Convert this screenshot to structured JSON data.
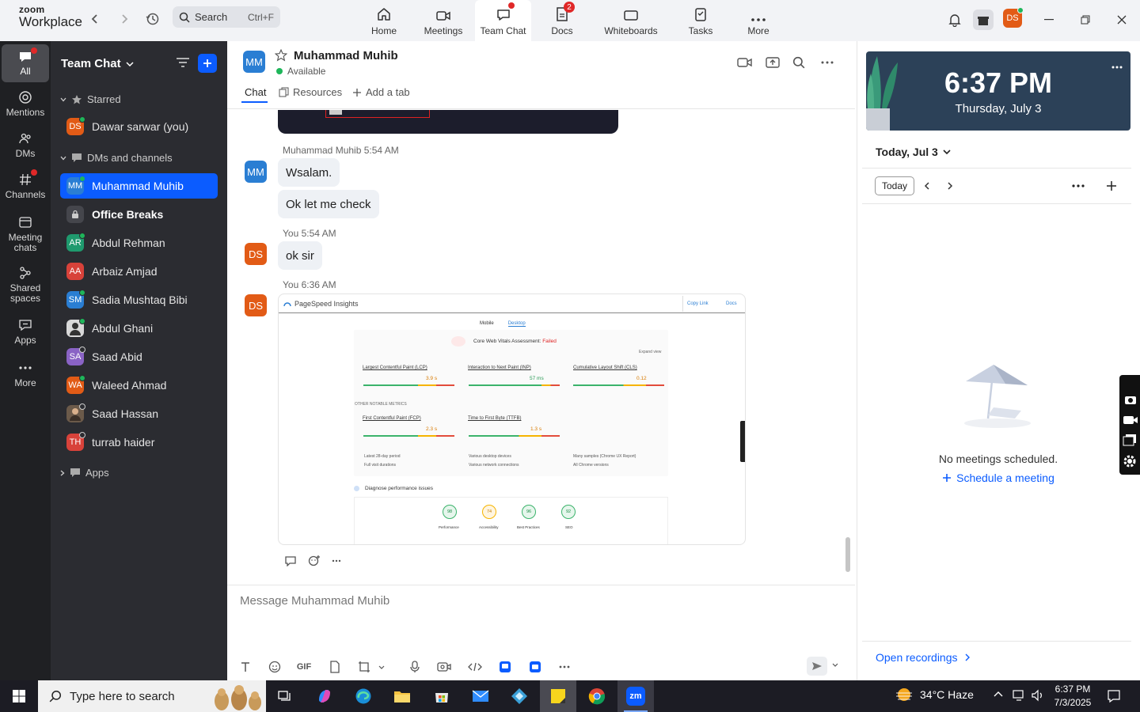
{
  "app": {
    "logo_line1": "zoom",
    "logo_line2": "Workplace"
  },
  "search": {
    "label": "Search",
    "shortcut": "Ctrl+F"
  },
  "nav": {
    "tabs": [
      {
        "label": "Home"
      },
      {
        "label": "Meetings"
      },
      {
        "label": "Team Chat"
      },
      {
        "label": "Docs",
        "badge": "2"
      },
      {
        "label": "Whiteboards"
      },
      {
        "label": "Tasks"
      },
      {
        "label": "More"
      }
    ]
  },
  "user": {
    "initials": "DS"
  },
  "rail": {
    "items": [
      {
        "label": "All"
      },
      {
        "label": "Mentions"
      },
      {
        "label": "DMs"
      },
      {
        "label": "Channels"
      },
      {
        "label": "Meeting chats"
      },
      {
        "label": "Shared spaces"
      },
      {
        "label": "Apps"
      },
      {
        "label": "More"
      }
    ]
  },
  "sidebar": {
    "title": "Team Chat",
    "starred_label": "Starred",
    "starred": [
      {
        "initials": "DS",
        "name": "Dawar sarwar (you)"
      }
    ],
    "dms_label": "DMs and channels",
    "dms": [
      {
        "initials": "MM",
        "name": "Muhammad Muhib"
      },
      {
        "initials": "",
        "name": "Office Breaks"
      },
      {
        "initials": "AR",
        "name": "Abdul Rehman"
      },
      {
        "initials": "AA",
        "name": "Arbaiz Amjad"
      },
      {
        "initials": "SM",
        "name": "Sadia Mushtaq Bibi"
      },
      {
        "initials": "",
        "name": "Abdul Ghani"
      },
      {
        "initials": "SA",
        "name": "Saad Abid"
      },
      {
        "initials": "WA",
        "name": "Waleed Ahmad"
      },
      {
        "initials": "",
        "name": "Saad Hassan"
      },
      {
        "initials": "TH",
        "name": "turrab haider"
      }
    ],
    "apps_label": "Apps"
  },
  "chat": {
    "contact_initials": "MM",
    "contact_name": "Muhammad Muhib",
    "contact_status": "Available",
    "tabs": {
      "chat": "Chat",
      "resources": "Resources",
      "add": "Add a tab"
    },
    "messages": [
      {
        "sender": "Muhammad Muhib",
        "time": "5:54 AM",
        "texts": [
          "Wsalam.",
          "Ok let me check"
        ]
      },
      {
        "sender": "You",
        "time": "5:54 AM",
        "texts": [
          "ok sir"
        ]
      },
      {
        "sender": "You",
        "time": "6:36 AM",
        "texts": []
      }
    ],
    "my_initials": "DS",
    "composer_placeholder": "Message Muhammad Muhib",
    "gif_label": "GIF"
  },
  "screenshot": {
    "app_title": "PageSpeed Insights",
    "copy_link": "Copy Link",
    "docs": "Docs",
    "mobile": "Mobile",
    "desktop": "Desktop",
    "cwv_label": "Core Web Vitals Assessment:",
    "cwv_result": "Failed",
    "expand": "Expand view",
    "metrics": [
      {
        "name": "Largest Contentful Paint (LCP)",
        "value": "3.9 s"
      },
      {
        "name": "Interaction to Next Paint (INP)",
        "value": "57 ms"
      },
      {
        "name": "Cumulative Layout Shift (CLS)",
        "value": "0.12"
      }
    ],
    "other_label": "OTHER NOTABLE METRICS",
    "other": [
      {
        "name": "First Contentful Paint (FCP)",
        "value": "2.3 s"
      },
      {
        "name": "Time to First Byte (TTFB)",
        "value": "1.3 s"
      }
    ],
    "info": [
      "Latest 28-day period",
      "Various desktop devices",
      "Many samples (Chrome UX Report)",
      "Full visit durations",
      "Various network connections",
      "All Chrome versions"
    ],
    "diagnose": "Diagnose performance issues",
    "scores": [
      {
        "value": "98",
        "label": "Performance"
      },
      {
        "value": "74",
        "label": "Accessibility"
      },
      {
        "value": "96",
        "label": "Best Practices"
      },
      {
        "value": "92",
        "label": "SEO"
      }
    ]
  },
  "calendar": {
    "time": "6:37 PM",
    "date": "Thursday, July 3",
    "today_heading": "Today, Jul 3",
    "today_button": "Today",
    "no_meetings": "No meetings scheduled.",
    "schedule": "Schedule a meeting",
    "open_recordings": "Open recordings"
  },
  "taskbar": {
    "search_placeholder": "Type here to search",
    "weather": "34°C  Haze",
    "time": "6:37 PM",
    "date": "7/3/2025",
    "zoom_label": "zm"
  }
}
